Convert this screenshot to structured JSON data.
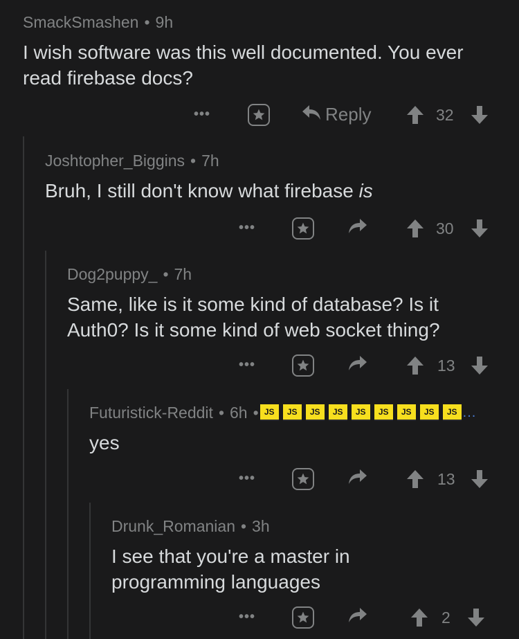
{
  "comments": [
    {
      "author": "SmackSmashen",
      "time": "9h",
      "body": "I wish software was this well documented. You ever read firebase docs?",
      "reply_label": "Reply",
      "score": "32"
    },
    {
      "author": "Joshtopher_Biggins",
      "time": "7h",
      "body_plain": "Bruh, I still don't know what firebase ",
      "body_italic": "is",
      "score": "30"
    },
    {
      "author": "Dog2puppy_",
      "time": "7h",
      "body": "Same, like is it some kind of database? Is it Auth0? Is it some kind of web socket thing?",
      "score": "13"
    },
    {
      "author": "Futuristick-Reddit",
      "time": "6h",
      "flair": [
        "JS",
        "JS",
        "JS",
        "JS",
        "JS",
        "JS",
        "JS",
        "JS",
        "JS"
      ],
      "flair_more": "...",
      "body": "yes",
      "score": "13"
    },
    {
      "author": "Drunk_Romanian",
      "time": "3h",
      "body": "I see that you're a master in programming languages",
      "score": "2"
    }
  ],
  "meta_separator": "•",
  "more_glyph": "•••",
  "icons": {
    "more": "more-options-icon",
    "award": "award-star-icon",
    "reply": "reply-arrow-icon",
    "upvote": "upvote-arrow-icon",
    "downvote": "downvote-arrow-icon"
  },
  "colors": {
    "background": "#1a1a1b",
    "text": "#d7dadc",
    "muted": "#818384",
    "thread_line": "#343536",
    "flair_bg": "#f7df1e"
  }
}
